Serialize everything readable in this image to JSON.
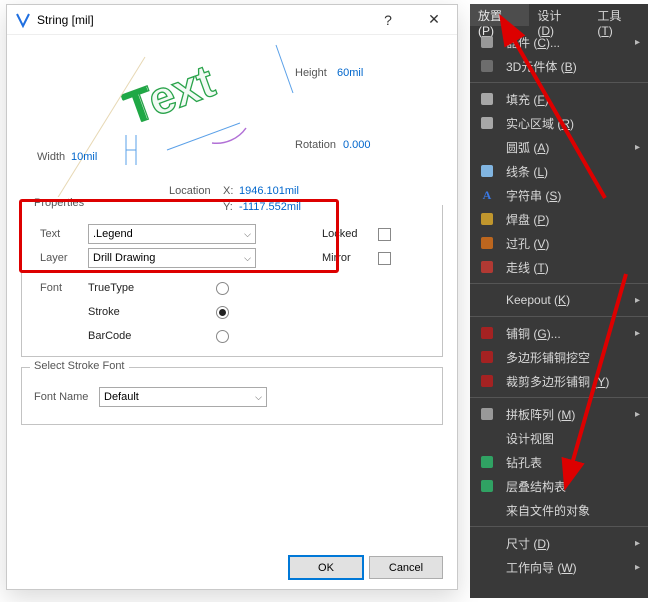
{
  "dialog": {
    "title": "String  [mil]",
    "preview": {
      "width_label": "Width",
      "width_value": "10mil",
      "height_label": "Height",
      "height_value": "60mil",
      "rotation_label": "Rotation",
      "rotation_value": "0.000",
      "location_label": "Location",
      "x_label": "X:",
      "x_value": "1946.101mil",
      "y_label": "Y:",
      "y_value": "-1117.552mil"
    },
    "properties": {
      "group_title": "Properties",
      "text_label": "Text",
      "text_value": ".Legend",
      "layer_label": "Layer",
      "layer_value": "Drill Drawing",
      "locked_label": "Locked",
      "mirror_label": "Mirror",
      "font_label": "Font",
      "font_options": [
        "TrueType",
        "Stroke",
        "BarCode"
      ]
    },
    "stroke": {
      "group_title": "Select Stroke Font",
      "fontname_label": "Font Name",
      "fontname_value": "Default"
    },
    "buttons": {
      "ok": "OK",
      "cancel": "Cancel"
    }
  },
  "menu": {
    "tabs": [
      {
        "label": "放置",
        "accel": "P"
      },
      {
        "label": "设计",
        "accel": "D"
      },
      {
        "label": "工具",
        "accel": "T"
      }
    ],
    "items": [
      {
        "label": "器件",
        "accel": "C",
        "arrow": true,
        "iconcolor": "#aaa"
      },
      {
        "label": "3D元件体",
        "accel": "B",
        "iconcolor": "#777"
      },
      {
        "sep": true
      },
      {
        "label": "填充",
        "accel": "F",
        "iconcolor": "#bbb"
      },
      {
        "label": "实心区域",
        "accel": "R",
        "iconcolor": "#bbb"
      },
      {
        "label": "圆弧",
        "accel": "A",
        "arrow": true,
        "noicon": true
      },
      {
        "label": "线条",
        "accel": "L",
        "iconcolor": "#8ecbff"
      },
      {
        "label": "字符串",
        "accel": "S",
        "textletter": "A",
        "iconcolor": "#3a79e6"
      },
      {
        "label": "焊盘",
        "accel": "P",
        "iconcolor": "#d8a72c"
      },
      {
        "label": "过孔",
        "accel": "V",
        "iconcolor": "#d46f1a"
      },
      {
        "label": "走线",
        "accel": "T",
        "iconcolor": "#c73a33"
      },
      {
        "sep": true
      },
      {
        "label": "Keepout",
        "accel": "K",
        "arrow": true,
        "noicon": true
      },
      {
        "sep": true
      },
      {
        "label": "铺铜",
        "accel": "G",
        "arrow": true,
        "iconcolor": "#b71e1e"
      },
      {
        "label": "多边形铺铜挖空",
        "iconcolor": "#b71e1e"
      },
      {
        "label": "裁剪多边形铺铜",
        "accel": "Y",
        "iconcolor": "#b71e1e"
      },
      {
        "sep": true
      },
      {
        "label": "拼板阵列",
        "accel": "M",
        "arrow": true,
        "iconcolor": "#aaa"
      },
      {
        "label": "设计视图",
        "noicon": true
      },
      {
        "label": "钻孔表",
        "iconcolor": "#2fb56b"
      },
      {
        "label": "层叠结构表",
        "iconcolor": "#2fb56b"
      },
      {
        "label": "来自文件的对象",
        "noicon": true
      },
      {
        "sep": true
      },
      {
        "label": "尺寸",
        "accel": "D",
        "arrow": true,
        "noicon": true
      },
      {
        "label": "工作向导",
        "accel": "W",
        "arrow": true,
        "noicon": true
      }
    ]
  }
}
